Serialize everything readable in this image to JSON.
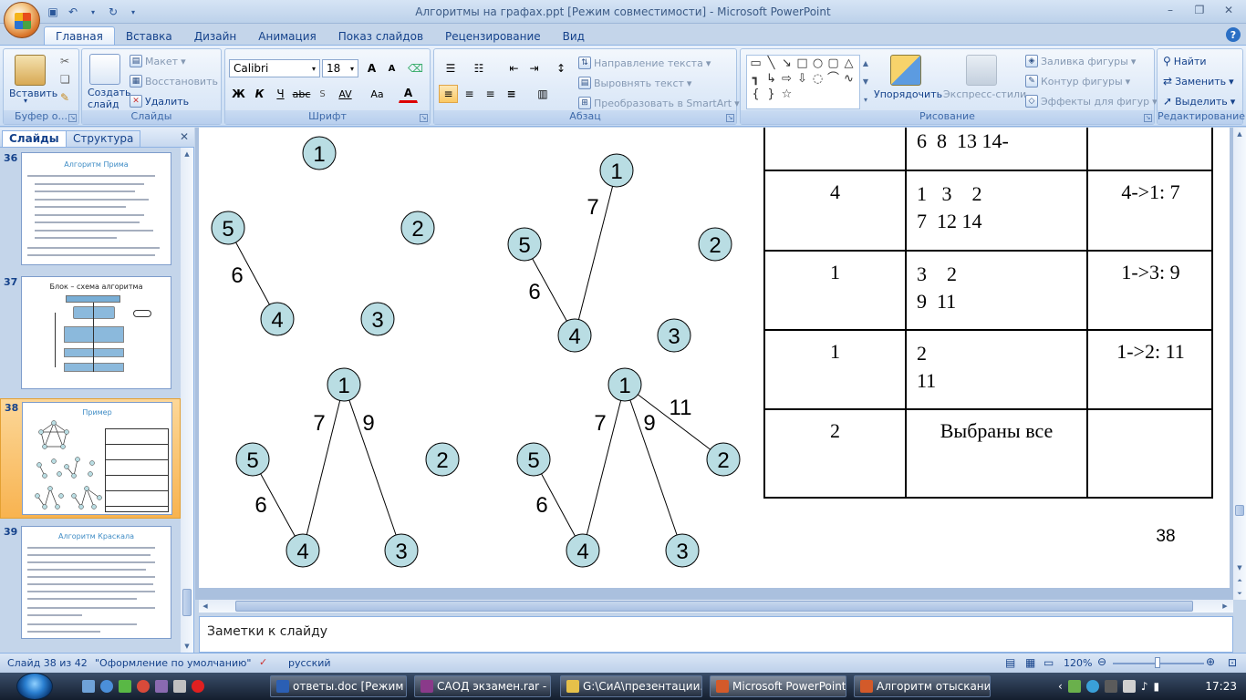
{
  "window": {
    "title": "Алгоритмы на графах.ppt [Режим совместимости] - Microsoft PowerPoint"
  },
  "tabs": [
    "Главная",
    "Вставка",
    "Дизайн",
    "Анимация",
    "Показ слайдов",
    "Рецензирование",
    "Вид"
  ],
  "ribbon": {
    "clipboard": {
      "label": "Буфер о...",
      "paste": "Вставить"
    },
    "slides": {
      "label": "Слайды",
      "new_slide": "Создать слайд",
      "layout": "Макет",
      "reset": "Восстановить",
      "delete": "Удалить"
    },
    "font": {
      "label": "Шрифт",
      "name": "Calibri",
      "size": "18",
      "bold": "Ж",
      "italic": "К",
      "underline": "Ч",
      "strike": "abc",
      "spacing": "AV",
      "case": "Aa",
      "color": "A",
      "grow": "A",
      "shrink": "A"
    },
    "paragraph": {
      "label": "Абзац",
      "text_direction": "Направление текста",
      "align_text": "Выровнять текст",
      "smartart": "Преобразовать в SmartArt"
    },
    "drawing": {
      "label": "Рисование",
      "arrange": "Упорядочить",
      "quick_styles": "Экспресс-стили",
      "fill": "Заливка фигуры",
      "outline": "Контур фигуры",
      "effects": "Эффекты для фигур"
    },
    "editing": {
      "label": "Редактирование",
      "find": "Найти",
      "replace": "Заменить",
      "select": "Выделить"
    }
  },
  "panel": {
    "tab_slides": "Слайды",
    "tab_outline": "Структура",
    "thumbs": [
      {
        "num": "36",
        "title": "Алгоритм Прима"
      },
      {
        "num": "37",
        "title": "Блок – схема алгоритма"
      },
      {
        "num": "38",
        "title": "Пример"
      },
      {
        "num": "39",
        "title": "Алгоритм Краскала"
      }
    ]
  },
  "slide": {
    "number": "38",
    "table": {
      "rows": [
        [
          "",
          "6  8  13 14-",
          ""
        ],
        [
          "4",
          "1   3    2\n7  12 14",
          "4->1: 7"
        ],
        [
          "1",
          "3    2\n9  11",
          "1->3: 9"
        ],
        [
          "1",
          "2\n11",
          "1->2: 11"
        ],
        [
          "2",
          "Выбраны все",
          ""
        ]
      ]
    },
    "graphs": {
      "g1": {
        "nodes": [
          "1",
          "2",
          "3",
          "4",
          "5"
        ],
        "edge_labels": [
          "6"
        ]
      },
      "g2": {
        "nodes": [
          "1",
          "2",
          "3",
          "4",
          "5"
        ],
        "edge_labels": [
          "7",
          "6"
        ]
      },
      "g3": {
        "nodes": [
          "1",
          "2",
          "3",
          "4",
          "5"
        ],
        "edge_labels": [
          "7",
          "9",
          "6"
        ]
      },
      "g4": {
        "nodes": [
          "1",
          "2",
          "3",
          "4",
          "5"
        ],
        "edge_labels": [
          "11",
          "7",
          "9",
          "6"
        ]
      }
    }
  },
  "notes": {
    "placeholder": "Заметки к слайду"
  },
  "status": {
    "slide_info": "Слайд 38 из 42",
    "theme": "\"Оформление по умолчанию\"",
    "language": "русский",
    "zoom": "120%"
  },
  "taskbar": {
    "items": [
      "ответы.doc [Режим ...",
      "САОД экзамен.rar - ...",
      "G:\\СиА\\презентации...",
      "Microsoft PowerPoint ...",
      "Алгоритм отыскани..."
    ],
    "clock": "17:23"
  },
  "colors": {
    "node_fill": "#b9dde3",
    "accent": "#3f8cc5",
    "selected_thumb": "#f8b350"
  }
}
